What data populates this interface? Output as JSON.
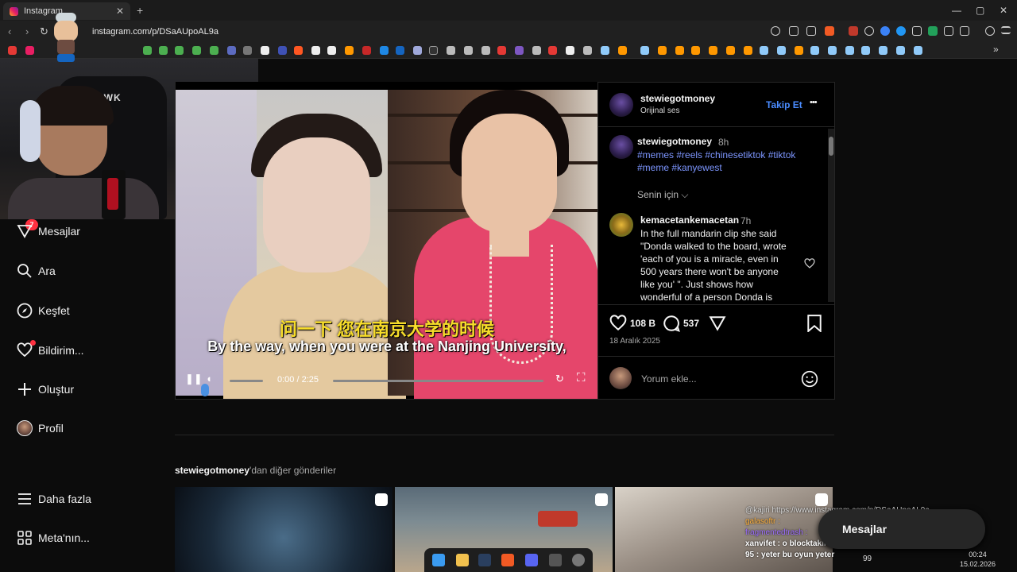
{
  "browser": {
    "tab_title": "Instagram",
    "tab_close": "✕",
    "new_tab": "+",
    "url": "instagram.com/p/DSaAUpoAL9a",
    "win_min": "—",
    "win_max": "▢",
    "win_close": "✕"
  },
  "webcam": {
    "chair_brand": "HAWK"
  },
  "sidebar": {
    "messages_badge": "7",
    "items": [
      {
        "label": "Mesajlar",
        "icon": "messenger-icon"
      },
      {
        "label": "Ara",
        "icon": "search-icon"
      },
      {
        "label": "Keşfet",
        "icon": "compass-icon"
      },
      {
        "label": "Bildirim...",
        "icon": "heart-icon"
      },
      {
        "label": "Oluştur",
        "icon": "plus-icon"
      },
      {
        "label": "Profil",
        "icon": "avatar"
      },
      {
        "label": "Daha fazla",
        "icon": "menu-icon"
      },
      {
        "label": "Meta'nın...",
        "icon": "grid-icon"
      }
    ]
  },
  "video": {
    "subtitle_cn": "问一下 您在南京大学的时候",
    "subtitle_en": "By the way, when you were at the Nanjing University,",
    "time": "0:00 / 2:25"
  },
  "post": {
    "author": "stewiegotmoney",
    "audio": "Orijinal ses",
    "follow": "Takip Et",
    "more": "•••",
    "caption_author": "stewiegotmoney",
    "caption_time": "8h",
    "hashtags_line1": "#memes #reels #chinesetiktok #tiktok",
    "hashtags_line2": "#meme #kanyewest",
    "for_you": "Senin için",
    "comment_author": "kemacetankemacetan",
    "comment_time": "7h",
    "comment_lines": [
      "In the full mandarin clip she said",
      "\"Donda walked to the board, wrote",
      "'each of you is a miracle, even in",
      "500 years there won't be anyone",
      "like you' \". Just shows how",
      "wonderful of a person Donda is"
    ],
    "likes": "108 B",
    "comments": "537",
    "date": "18 Aralık 2025",
    "comment_placeholder": "Yorum ekle..."
  },
  "more_posts": {
    "author": "stewiegotmoney",
    "suffix": "'dan diğer gönderiler"
  },
  "overlay": {
    "chat_lines": [
      "@kajiri https://www.instagram.com/p/DSaAUpoAL9a",
      "galasoftr :",
      "fragmentedtrash :",
      "xanvifet : o blocktakiler koko satısından vurmus parayı",
      "95 : yeter bu oyun yeter"
    ],
    "messages_popup": "Mesajlar",
    "tray_num": "99",
    "clock_time": "00:24",
    "clock_date": "15.02.2026"
  }
}
